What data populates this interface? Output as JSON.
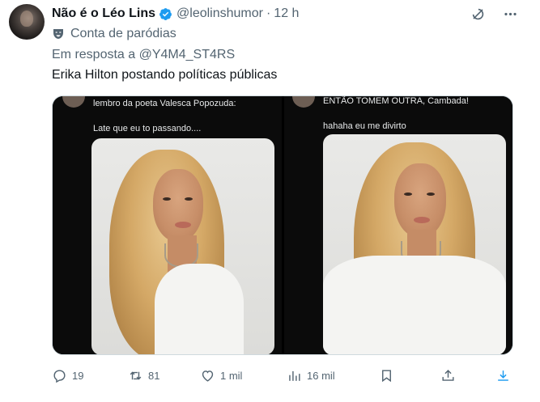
{
  "author": {
    "name": "Não é o Léo Lins",
    "handle": "@leolinshumor",
    "dot": "·",
    "time": "12 h",
    "parody_label": "Conta de paródias"
  },
  "reply": {
    "prefix": "Em resposta a",
    "mention": "@Y4M4_ST4RS"
  },
  "tweet_text": "Erika Hilton postando políticas públicas",
  "media": {
    "left": {
      "line1": "lembro da poeta Valesca Popozuda:",
      "line2": "Late que eu to passando...."
    },
    "right": {
      "line1": "ENTÃO TOMEM OUTRA, Cambada!",
      "line2": "hahaha eu me divirto"
    }
  },
  "actions": {
    "replies": "19",
    "retweets": "81",
    "likes": "1 mil",
    "views": "16 mil"
  },
  "colors": {
    "text": "#0f1419",
    "secondary": "#536471",
    "verified": "#1d9bf0",
    "border": "#cfd9de"
  },
  "icons": [
    "verified-badge-icon",
    "grok-icon",
    "more-icon",
    "parody-mask-icon",
    "reply-icon",
    "retweet-icon",
    "like-icon",
    "views-icon",
    "bookmark-icon",
    "share-icon",
    "download-icon"
  ]
}
